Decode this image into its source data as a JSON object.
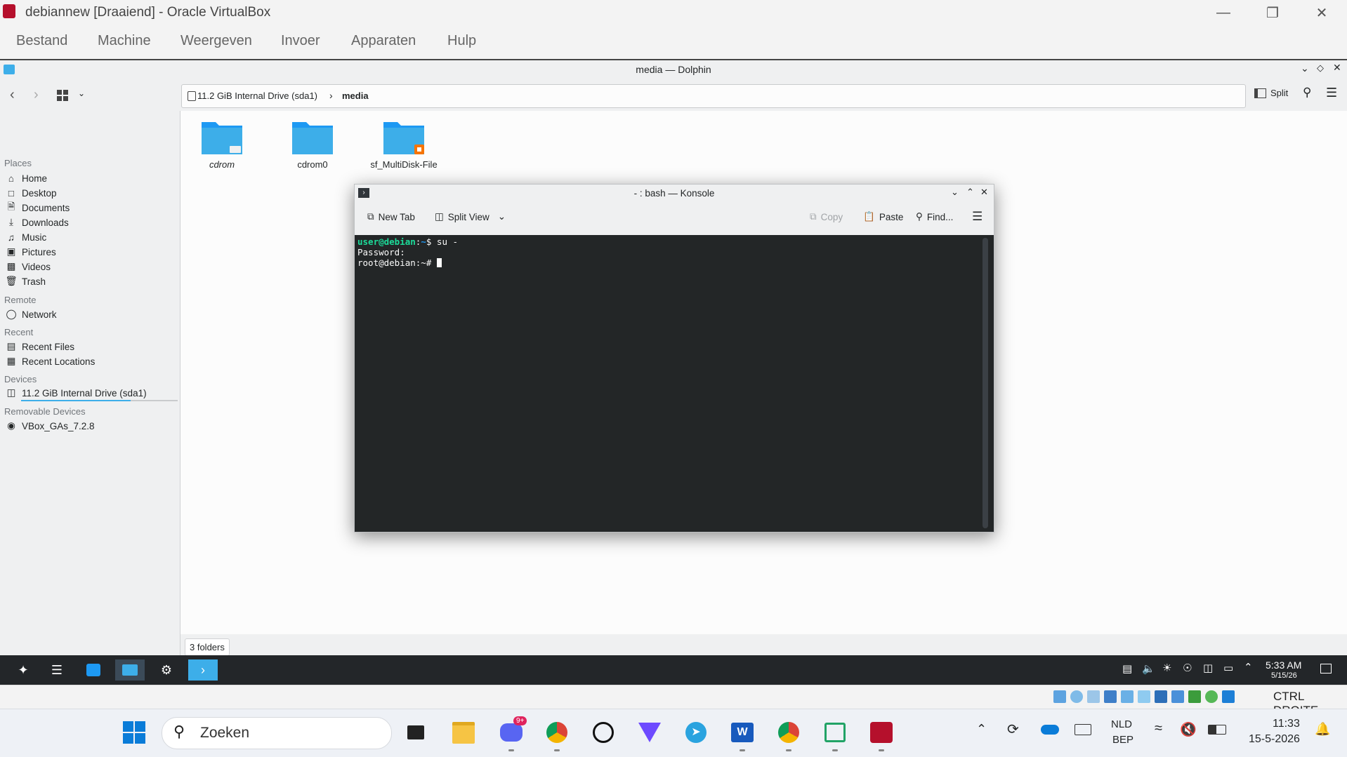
{
  "vbox": {
    "title": "debiannew [Draaiend] - Oracle VirtualBox",
    "menu": [
      "Bestand",
      "Machine",
      "Weergeven",
      "Invoer",
      "Apparaten",
      "Hulp"
    ],
    "hostkey": "CTRL DROITE"
  },
  "dolphin": {
    "title": "media — Dolphin",
    "breadcrumb": {
      "drive": "11.2 GiB Internal Drive (sda1)",
      "current": "media"
    },
    "split_label": "Split",
    "sidebar": {
      "places_heading": "Places",
      "places": [
        "Home",
        "Desktop",
        "Documents",
        "Downloads",
        "Music",
        "Pictures",
        "Videos",
        "Trash"
      ],
      "remote_heading": "Remote",
      "remote": [
        "Network"
      ],
      "recent_heading": "Recent",
      "recent": [
        "Recent Files",
        "Recent Locations"
      ],
      "devices_heading": "Devices",
      "devices": [
        "11.2 GiB Internal Drive (sda1)"
      ],
      "removable_heading": "Removable Devices",
      "removable": [
        "VBox_GAs_7.2.8"
      ]
    },
    "folders": [
      "cdrom",
      "cdrom0",
      "sf_MultiDisk-File"
    ],
    "status": "3 folders"
  },
  "konsole": {
    "title": "- : bash — Konsole",
    "toolbar": {
      "new_tab": "New Tab",
      "split_view": "Split View",
      "copy": "Copy",
      "paste": "Paste",
      "find": "Find..."
    },
    "lines": [
      {
        "user": "user@debian",
        "sep": ":",
        "path": "~",
        "prompt": "$ ",
        "cmd": "su -"
      },
      {
        "text": "Password:"
      },
      {
        "text": "root@debian:~# "
      }
    ]
  },
  "guest_panel": {
    "time": "5:33 AM",
    "date": "5/15/26"
  },
  "windows": {
    "search_placeholder": "Zoeken",
    "lang": "NLD",
    "layout": "BEP",
    "time": "11:33",
    "date": "15-5-2026",
    "badge": "9+"
  },
  "colors": {
    "accent": "#3daee9",
    "terminal_bg": "#232627",
    "prompt_user": "#1cdc9a",
    "prompt_path": "#1d99f3"
  }
}
